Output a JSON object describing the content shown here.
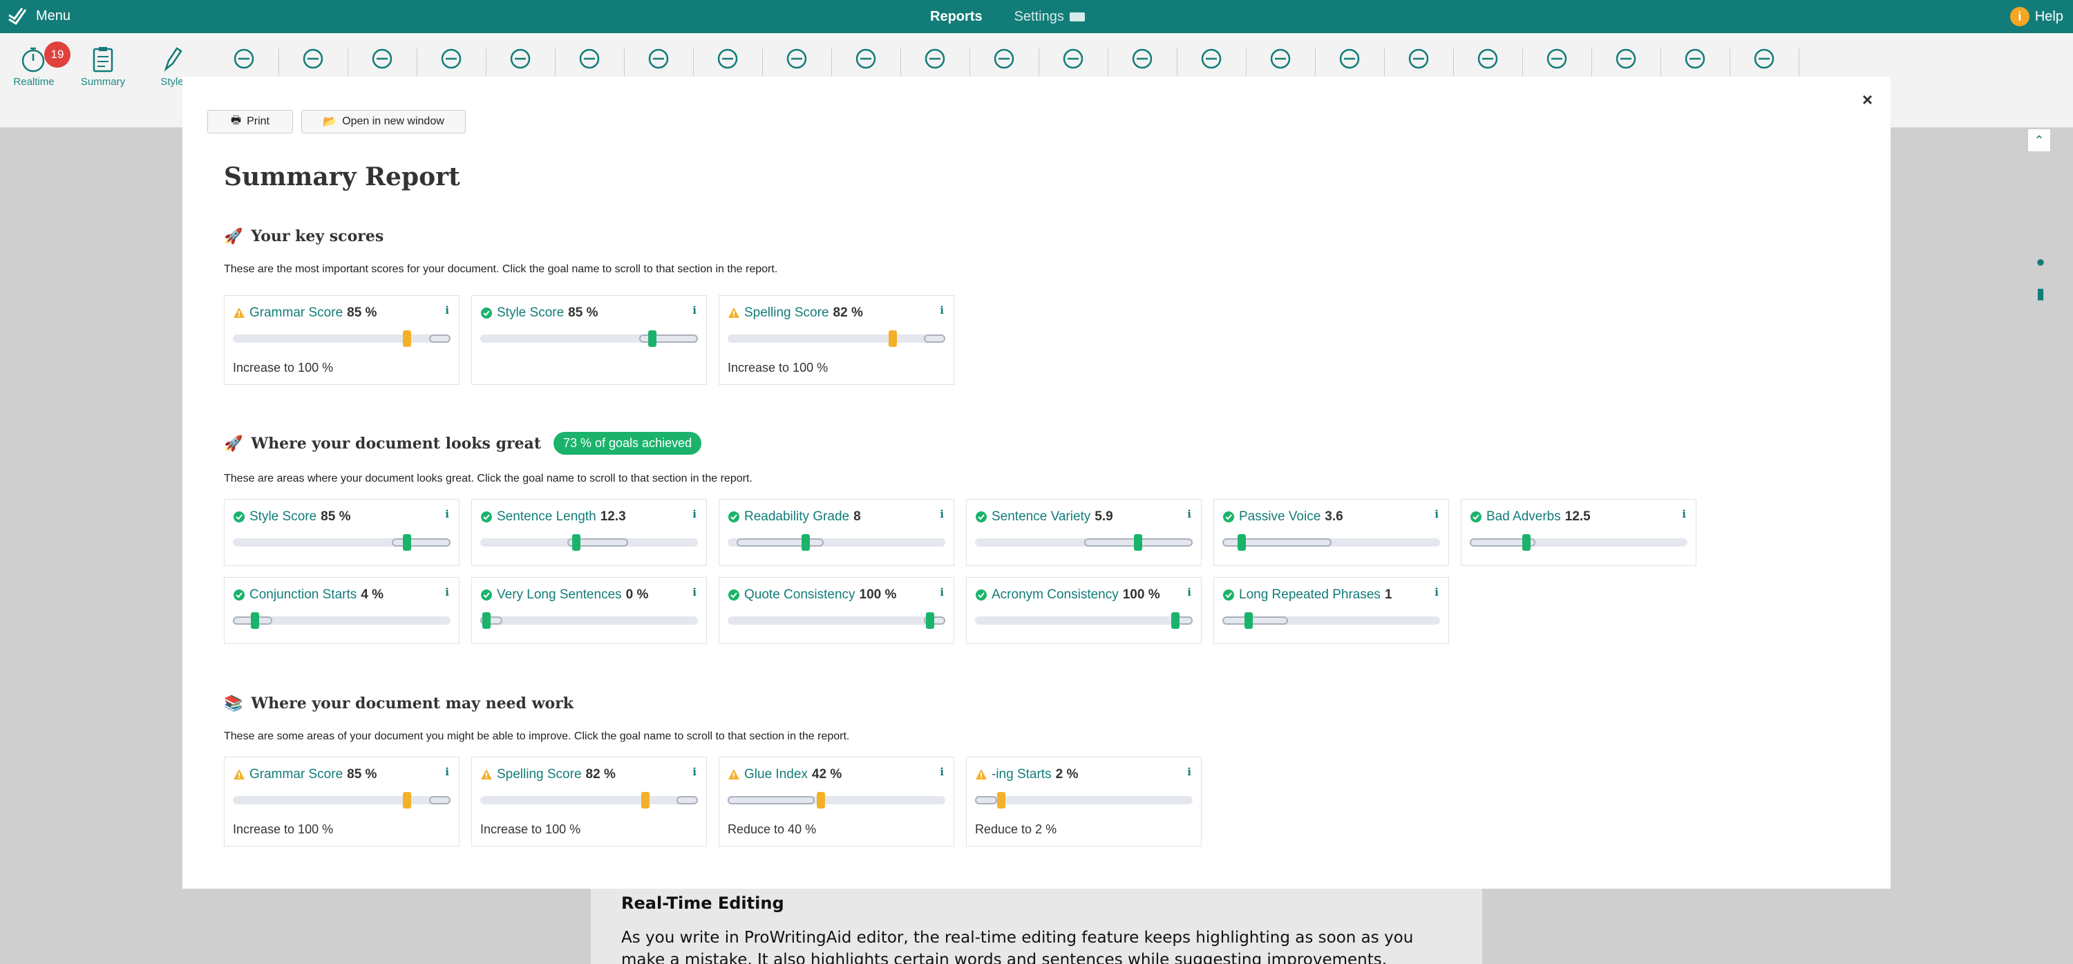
{
  "topbar": {
    "menu_label": "Menu",
    "tabs": [
      {
        "label": "Reports",
        "active": true
      },
      {
        "label": "Settings",
        "active": false
      }
    ],
    "help_label": "Help"
  },
  "toolbar": {
    "realtime_badge": "19",
    "labeled_tools": [
      {
        "label": "Realtime"
      },
      {
        "label": "Summary"
      },
      {
        "label": "Style"
      }
    ],
    "tools": [
      "grammar-text-icon",
      "book-icon",
      "sleepy-face-icon",
      "shuffle-icon",
      "repeat-icon",
      "sound-wave-icon",
      "share-nodes-icon",
      "ruler-icon",
      "bridge-icon",
      "glasses-icon",
      "highlighter-icon",
      "quote-bubble-icon",
      "dictionary-icon",
      "gender-icon",
      "music-note-icon",
      "ear-icon",
      "dots-icon",
      "brb-icon",
      "chat-bubbles-icon",
      "gauge-icon",
      "brain-icon",
      "house-settings-icon",
      "search-text-icon"
    ]
  },
  "document": {
    "heading": "Real-Time Editing",
    "paragraph": "As you write in ProWritingAid editor, the real-time editing feature keeps highlighting as soon as you make a mistake. It also highlights certain words and sentences while suggesting improvements."
  },
  "modal": {
    "print_label": "Print",
    "open_label": "Open in new window",
    "close_label": "×",
    "title": "Summary Report"
  },
  "colors": {
    "teal": "#127c78",
    "ok_green": "#1bb36c",
    "warn_orange": "#f5b02a"
  },
  "sections": [
    {
      "id": "key",
      "emoji": "🚀",
      "title": "Your key scores",
      "description": "These are the most important scores for your document. Click the goal name to scroll to that section in the report.",
      "cards": [
        {
          "name": "Grammar Score",
          "value": "85 %",
          "status": "warning",
          "level": 0.8,
          "range": [
            0.9,
            1.0
          ],
          "target": "Increase to 100 %"
        },
        {
          "name": "Style Score",
          "value": "85 %",
          "status": "ok",
          "level": 0.79,
          "range": [
            0.73,
            1.0
          ]
        },
        {
          "name": "Spelling Score",
          "value": "82 %",
          "status": "warning",
          "level": 0.76,
          "range": [
            0.9,
            1.0
          ],
          "target": "Increase to 100 %"
        }
      ]
    },
    {
      "id": "great",
      "emoji": "🚀",
      "title": "Where your document looks great",
      "pill": "73 % of goals achieved",
      "description": "These are areas where your document looks great. Click the goal name to scroll to that section in the report.",
      "cards": [
        {
          "name": "Style Score",
          "value": "85 %",
          "status": "ok",
          "level": 0.8,
          "range": [
            0.73,
            1.0
          ]
        },
        {
          "name": "Sentence Length",
          "value": "12.3",
          "status": "ok",
          "level": 0.44,
          "range": [
            0.4,
            0.68
          ]
        },
        {
          "name": "Readability Grade",
          "value": "8",
          "status": "ok",
          "level": 0.36,
          "range": [
            0.04,
            0.44
          ]
        },
        {
          "name": "Sentence Variety",
          "value": "5.9",
          "status": "ok",
          "level": 0.75,
          "range": [
            0.5,
            1.0
          ]
        },
        {
          "name": "Passive Voice",
          "value": "3.6",
          "status": "ok",
          "level": 0.09,
          "range": [
            0.0,
            0.5
          ]
        },
        {
          "name": "Bad Adverbs",
          "value": "12.5",
          "status": "ok",
          "level": 0.26,
          "range": [
            0.0,
            0.3
          ]
        },
        {
          "name": "Conjunction Starts",
          "value": "4 %",
          "status": "ok",
          "level": 0.1,
          "range": [
            0.0,
            0.18
          ]
        },
        {
          "name": "Very Long Sentences",
          "value": "0 %",
          "status": "ok",
          "level": 0.03,
          "range": [
            0.0,
            0.1
          ]
        },
        {
          "name": "Quote Consistency",
          "value": "100 %",
          "status": "ok",
          "level": 0.93,
          "range": [
            0.9,
            1.0
          ]
        },
        {
          "name": "Acronym Consistency",
          "value": "100 %",
          "status": "ok",
          "level": 0.92,
          "range": [
            0.9,
            1.0
          ]
        },
        {
          "name": "Long Repeated Phrases",
          "value": "1",
          "status": "ok",
          "level": 0.12,
          "range": [
            0.0,
            0.3
          ]
        }
      ]
    },
    {
      "id": "work",
      "emoji": "📚",
      "title": "Where your document may need work",
      "description": "These are some areas of your document you might be able to improve. Click the goal name to scroll to that section in the report.",
      "cards": [
        {
          "name": "Grammar Score",
          "value": "85 %",
          "status": "warning",
          "level": 0.8,
          "range": [
            0.9,
            1.0
          ],
          "target": "Increase to 100 %"
        },
        {
          "name": "Spelling Score",
          "value": "82 %",
          "status": "warning",
          "level": 0.76,
          "range": [
            0.9,
            1.0
          ],
          "target": "Increase to 100 %"
        },
        {
          "name": "Glue Index",
          "value": "42 %",
          "status": "warning",
          "level": 0.43,
          "range": [
            0.0,
            0.4
          ],
          "target": "Reduce to 40 %"
        },
        {
          "name": "-ing Starts",
          "value": "2 %",
          "status": "warning",
          "level": 0.12,
          "range": [
            0.0,
            0.1
          ],
          "target": "Reduce to 2 %"
        }
      ]
    }
  ]
}
